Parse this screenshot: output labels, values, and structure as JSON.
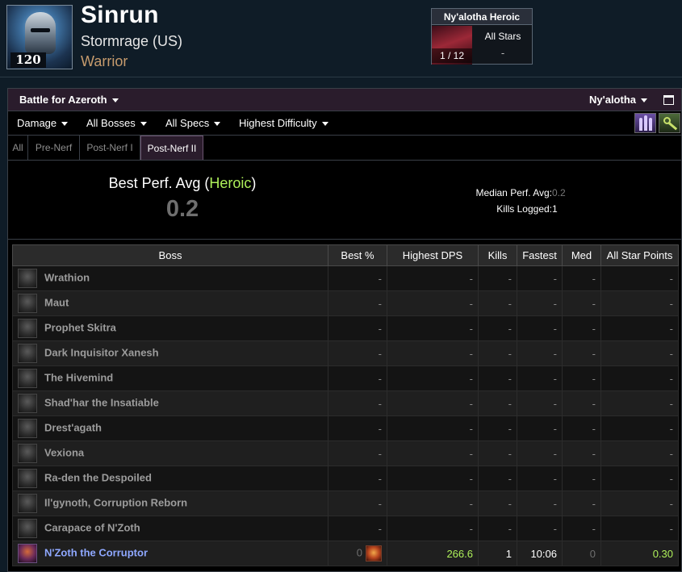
{
  "character": {
    "name": "Sinrun",
    "server": "Stormrage (US)",
    "class": "Warrior",
    "level": "120",
    "class_color": "#c69b6d"
  },
  "raid_box": {
    "title": "Ny'alotha Heroic",
    "progress": "1 / 12",
    "stars_label": "All Stars",
    "stars_value": "-"
  },
  "toolbar": {
    "expansion": "Battle for Azeroth",
    "zone": "Ny'alotha"
  },
  "filters": {
    "metric": "Damage",
    "bosses": "All Bosses",
    "specs": "All Specs",
    "difficulty": "Highest Difficulty"
  },
  "partition_tabs": [
    "All",
    "Pre-Nerf",
    "Post-Nerf I",
    "Post-Nerf II"
  ],
  "active_tab": "Post-Nerf II",
  "summary": {
    "best_label": "Best Perf. Avg",
    "best_open": " (",
    "best_difficulty": "Heroic",
    "best_close": ")",
    "best_value": "0.2",
    "median_label": "Median Perf. Avg:",
    "median_value": "0.2",
    "kills_label": "Kills Logged:",
    "kills_value": "1"
  },
  "table": {
    "columns": [
      "Boss",
      "Best %",
      "Highest DPS",
      "Kills",
      "Fastest",
      "Med",
      "All Star Points"
    ],
    "rows": [
      {
        "boss": "Wrathion",
        "best": "-",
        "dps": "-",
        "kills": "-",
        "fastest": "-",
        "med": "-",
        "points": "-"
      },
      {
        "boss": "Maut",
        "best": "-",
        "dps": "-",
        "kills": "-",
        "fastest": "-",
        "med": "-",
        "points": "-"
      },
      {
        "boss": "Prophet Skitra",
        "best": "-",
        "dps": "-",
        "kills": "-",
        "fastest": "-",
        "med": "-",
        "points": "-"
      },
      {
        "boss": "Dark Inquisitor Xanesh",
        "best": "-",
        "dps": "-",
        "kills": "-",
        "fastest": "-",
        "med": "-",
        "points": "-"
      },
      {
        "boss": "The Hivemind",
        "best": "-",
        "dps": "-",
        "kills": "-",
        "fastest": "-",
        "med": "-",
        "points": "-"
      },
      {
        "boss": "Shad'har the Insatiable",
        "best": "-",
        "dps": "-",
        "kills": "-",
        "fastest": "-",
        "med": "-",
        "points": "-"
      },
      {
        "boss": "Drest'agath",
        "best": "-",
        "dps": "-",
        "kills": "-",
        "fastest": "-",
        "med": "-",
        "points": "-"
      },
      {
        "boss": "Vexiona",
        "best": "-",
        "dps": "-",
        "kills": "-",
        "fastest": "-",
        "med": "-",
        "points": "-"
      },
      {
        "boss": "Ra-den the Despoiled",
        "best": "-",
        "dps": "-",
        "kills": "-",
        "fastest": "-",
        "med": "-",
        "points": "-"
      },
      {
        "boss": "Il'gynoth, Corruption Reborn",
        "best": "-",
        "dps": "-",
        "kills": "-",
        "fastest": "-",
        "med": "-",
        "points": "-"
      },
      {
        "boss": "Carapace of N'Zoth",
        "best": "-",
        "dps": "-",
        "kills": "-",
        "fastest": "-",
        "med": "-",
        "points": "-"
      },
      {
        "boss": "N'Zoth the Corruptor",
        "best": "0",
        "dps": "266.6",
        "kills": "1",
        "fastest": "10:06",
        "med": "0",
        "points": "0.30"
      }
    ]
  }
}
